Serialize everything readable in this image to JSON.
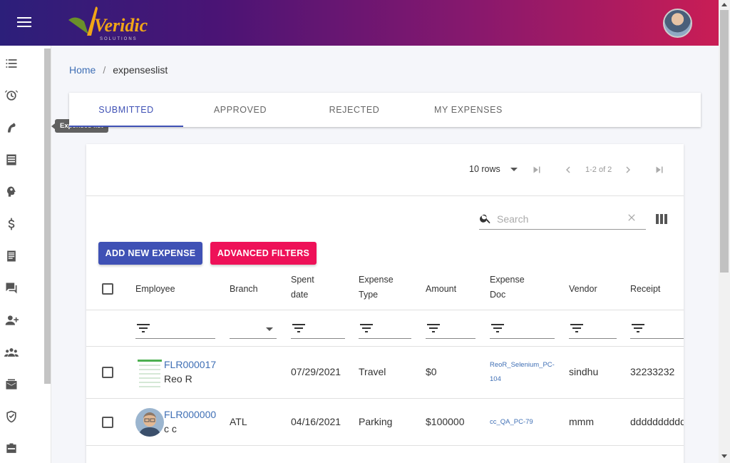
{
  "header": {
    "logo_text": "Veridic",
    "logo_sub": "SOLUTIONS"
  },
  "sidebar": {
    "items": [
      {
        "icon": "checklist-icon"
      },
      {
        "icon": "alarm-icon"
      },
      {
        "icon": "expenses-icon"
      },
      {
        "icon": "receipt-icon"
      },
      {
        "icon": "brain-icon"
      },
      {
        "icon": "dollar-icon"
      },
      {
        "icon": "document-icon"
      },
      {
        "icon": "chat-icon"
      },
      {
        "icon": "add-user-icon"
      },
      {
        "icon": "group-icon"
      },
      {
        "icon": "mail-icon"
      },
      {
        "icon": "shield-icon"
      },
      {
        "icon": "briefcase-icon"
      }
    ],
    "tooltip": "Expenses list"
  },
  "breadcrumb": {
    "home": "Home",
    "separator": "/",
    "current": "expenseslist"
  },
  "tabs": [
    "SUBMITTED",
    "APPROVED",
    "REJECTED",
    "MY EXPENSES"
  ],
  "active_tab": 0,
  "toolbar": {
    "rows_label": "10 rows",
    "page_range": "1-2 of 2",
    "search_placeholder": "Search",
    "add_label": "ADD NEW EXPENSE",
    "advanced_label": "ADVANCED FILTERS"
  },
  "table": {
    "headers": {
      "employee": "Employee",
      "branch": "Branch",
      "spent_1": "Spent",
      "spent_2": "date",
      "type_1": "Expense",
      "type_2": "Type",
      "amount": "Amount",
      "doc_1": "Expense",
      "doc_2": "Doc",
      "vendor": "Vendor",
      "receipt": "Receipt"
    },
    "rows": [
      {
        "id": "FLR000017",
        "name": "Reo R",
        "branch": "",
        "date": "07/29/2021",
        "type": "Travel",
        "amount": "$0",
        "doc_1": "ReoR_Selenium_PC-",
        "doc_2": "104",
        "vendor": "sindhu",
        "receipt": "32233232"
      },
      {
        "id": "FLR000000",
        "name": "c c",
        "branch": "ATL",
        "date": "04/16/2021",
        "type": "Parking",
        "amount": "$100000",
        "doc_1": "cc_QA_PC-79",
        "doc_2": "",
        "vendor": "mmm",
        "receipt": "dddddddddd"
      }
    ]
  },
  "colors": {
    "primary": "#3f51b5",
    "accent": "#ee1158",
    "link": "#3f6fb5"
  }
}
